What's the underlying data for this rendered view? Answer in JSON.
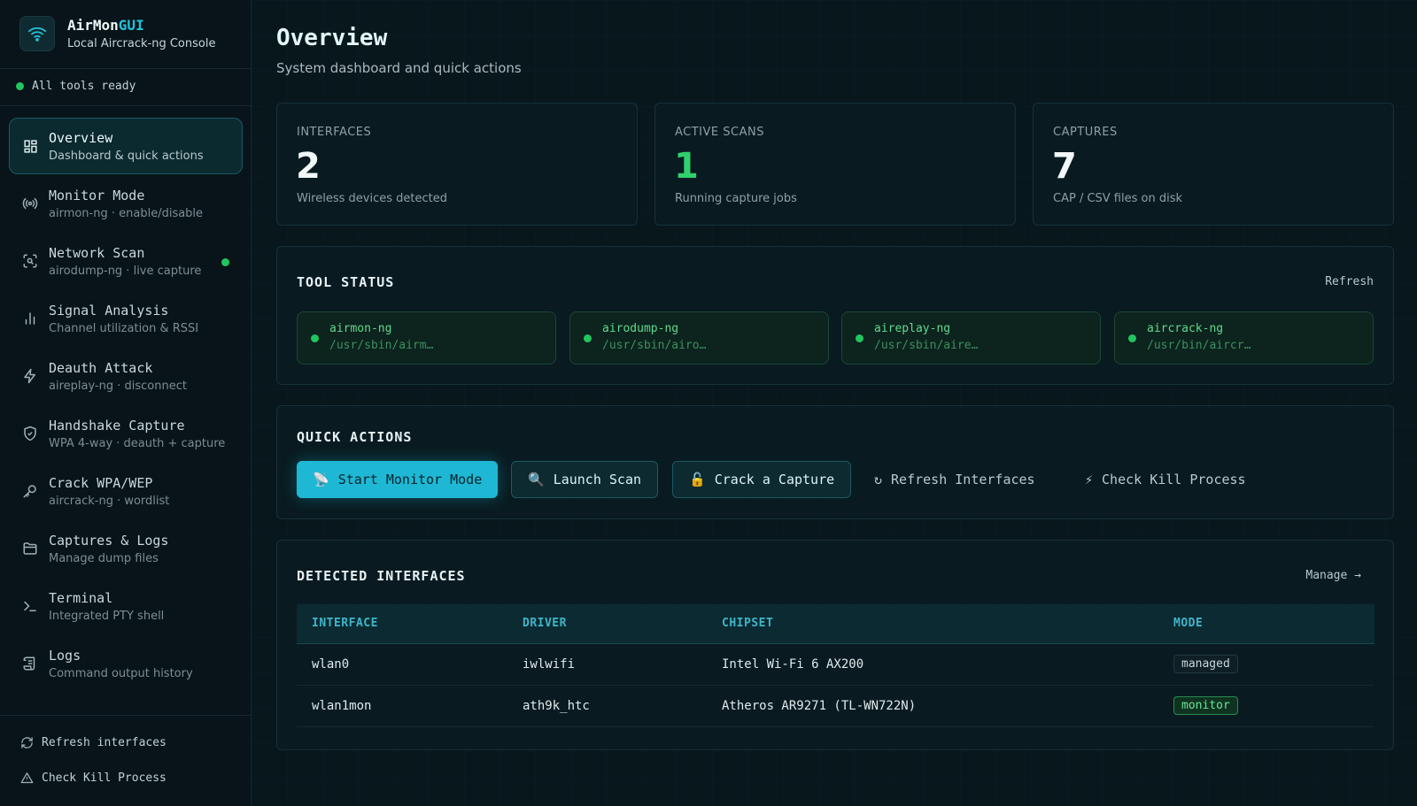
{
  "brand": {
    "title_main": "AirMon",
    "title_accent": "GUI",
    "subtitle": "Local Aircrack-ng Console",
    "icon": "wifi-icon"
  },
  "status": {
    "text": "All tools ready",
    "color": "#22c55e"
  },
  "nav": {
    "items": [
      {
        "title": "Overview",
        "sub": "Dashboard & quick actions",
        "icon": "dashboard-icon",
        "active": true
      },
      {
        "title": "Monitor Mode",
        "sub": "airmon-ng · enable/disable",
        "icon": "broadcast-icon"
      },
      {
        "title": "Network Scan",
        "sub": "airodump-ng · live capture",
        "icon": "scan-icon",
        "live": true
      },
      {
        "title": "Signal Analysis",
        "sub": "Channel utilization & RSSI",
        "icon": "bar-chart-icon"
      },
      {
        "title": "Deauth Attack",
        "sub": "aireplay-ng · disconnect",
        "icon": "lightning-icon"
      },
      {
        "title": "Handshake Capture",
        "sub": "WPA 4-way · deauth + capture",
        "icon": "shield-icon"
      },
      {
        "title": "Crack WPA/WEP",
        "sub": "aircrack-ng · wordlist",
        "icon": "key-icon"
      },
      {
        "title": "Captures & Logs",
        "sub": "Manage dump files",
        "icon": "folder-icon"
      },
      {
        "title": "Terminal",
        "sub": "Integrated PTY shell",
        "icon": "terminal-icon"
      },
      {
        "title": "Logs",
        "sub": "Command output history",
        "icon": "scroll-icon"
      }
    ]
  },
  "sidebar_footer": {
    "refresh": "Refresh interfaces",
    "kill": "Check Kill Process"
  },
  "page": {
    "title": "Overview",
    "subtitle": "System dashboard and quick actions"
  },
  "stats": [
    {
      "label": "INTERFACES",
      "value": "2",
      "desc": "Wireless devices detected"
    },
    {
      "label": "ACTIVE SCANS",
      "value": "1",
      "desc": "Running capture jobs",
      "accent": "#31d06e"
    },
    {
      "label": "CAPTURES",
      "value": "7",
      "desc": "CAP / CSV files on disk"
    }
  ],
  "tool_status": {
    "title": "TOOL STATUS",
    "refresh": "Refresh",
    "tools": [
      {
        "name": "airmon-ng",
        "path": "/usr/sbin/airm…"
      },
      {
        "name": "airodump-ng",
        "path": "/usr/sbin/airo…"
      },
      {
        "name": "aireplay-ng",
        "path": "/usr/sbin/aire…"
      },
      {
        "name": "aircrack-ng",
        "path": "/usr/bin/aircr…"
      }
    ]
  },
  "quick_actions": {
    "title": "QUICK ACTIONS",
    "start_monitor": {
      "glyph": "📡",
      "label": "Start Monitor Mode"
    },
    "launch_scan": {
      "glyph": "🔍",
      "label": "Launch Scan"
    },
    "crack_capture": {
      "glyph": "🔓",
      "label": "Crack a Capture"
    },
    "refresh_interfaces": {
      "glyph": "↻",
      "label": "Refresh Interfaces"
    },
    "check_kill": {
      "glyph": "⚡",
      "label": "Check Kill Process"
    }
  },
  "interfaces": {
    "title": "DETECTED INTERFACES",
    "manage": "Manage →",
    "columns": [
      "INTERFACE",
      "DRIVER",
      "CHIPSET",
      "MODE"
    ],
    "rows": [
      {
        "iface": "wlan0",
        "driver": "iwlwifi",
        "chipset": "Intel Wi-Fi 6 AX200",
        "mode": "managed"
      },
      {
        "iface": "wlan1mon",
        "driver": "ath9k_htc",
        "chipset": "Atheros AR9271 (TL-WN722N)",
        "mode": "monitor"
      }
    ]
  },
  "colors": {
    "accent": "#1eb8d4",
    "success": "#22c55e",
    "background": "#07141a"
  }
}
